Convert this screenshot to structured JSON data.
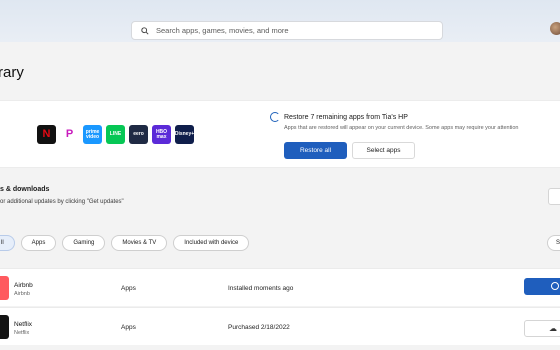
{
  "search": {
    "placeholder": "Search apps, games, movies, and more"
  },
  "page": {
    "title": "rary"
  },
  "restore_panel": {
    "title": "Restore 7 remaining apps from Tia's HP",
    "subtitle": "Apps that are restored will appear on your current device. Some apps may require your attention",
    "restore_all": "Restore all",
    "select_apps": "Select apps",
    "apps": [
      {
        "name": "netflix-icon",
        "label": "N",
        "color": "#111111",
        "text_color": "#e50914"
      },
      {
        "name": "pandora-icon",
        "label": "P",
        "color": "#ffffff",
        "text_color": "#c81bbd"
      },
      {
        "name": "prime-video-icon",
        "label": "prime video",
        "color": "#1a98ff",
        "text_color": "#ffffff"
      },
      {
        "name": "line-icon",
        "label": "LINE",
        "color": "#06c755",
        "text_color": "#ffffff"
      },
      {
        "name": "eero-icon",
        "label": "eero",
        "color": "#1f2a44",
        "text_color": "#ffffff"
      },
      {
        "name": "hbo-max-icon",
        "label": "HBO max",
        "color": "#5b2ad8",
        "text_color": "#ffffff"
      },
      {
        "name": "disney-plus-icon",
        "label": "Disney+",
        "color": "#0f1e4b",
        "text_color": "#ffffff"
      }
    ]
  },
  "updates": {
    "title": "s & downloads",
    "subtitle": "or additional updates by clicking \"Get updates\""
  },
  "filters": [
    {
      "label": "ll",
      "active": true
    },
    {
      "label": "Apps",
      "active": false
    },
    {
      "label": "Gaming",
      "active": false
    },
    {
      "label": "Movies & TV",
      "active": false
    },
    {
      "label": "Included with device",
      "active": false
    }
  ],
  "sort_label": "S",
  "library": [
    {
      "name": "Airbnb",
      "publisher": "Airbnb",
      "category": "Apps",
      "status": "Installed moments ago",
      "logo_color": "#ff5a5f",
      "action": "open"
    },
    {
      "name": "Netflix",
      "publisher": "Netflix",
      "category": "Apps",
      "status": "Purchased 2/18/2022",
      "logo_color": "#141414",
      "action": "download"
    }
  ],
  "colors": {
    "accent": "#1f5ebd"
  }
}
